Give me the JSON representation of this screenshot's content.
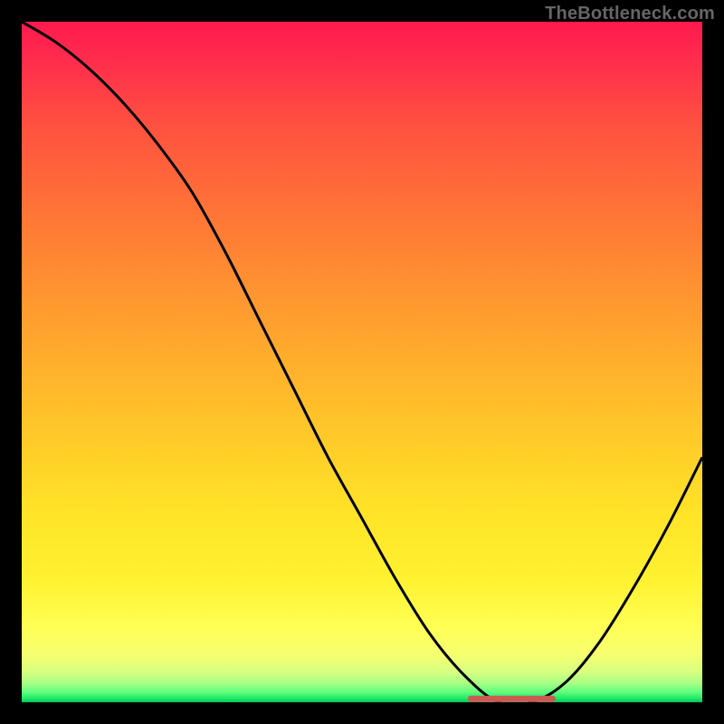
{
  "watermark": "TheBottleneck.com",
  "chart_data": {
    "type": "line",
    "title": "",
    "xlabel": "",
    "ylabel": "",
    "xlim": [
      0,
      100
    ],
    "ylim": [
      0,
      100
    ],
    "grid": false,
    "legend": false,
    "series": [
      {
        "name": "bottleneck-curve",
        "x": [
          0,
          5,
          10,
          15,
          20,
          25,
          30,
          35,
          40,
          45,
          50,
          55,
          60,
          65,
          70,
          75,
          80,
          85,
          90,
          95,
          100
        ],
        "values": [
          100,
          97,
          93,
          88,
          82,
          75,
          66,
          56,
          46,
          36,
          27,
          18,
          10,
          4,
          0,
          0,
          3,
          9,
          17,
          26,
          36
        ]
      },
      {
        "name": "highlight-segment",
        "x": [
          66,
          78
        ],
        "values": [
          0.5,
          0.5
        ]
      }
    ],
    "highlight_range": {
      "start": 66,
      "end": 78
    },
    "background_gradient_stops": [
      {
        "pct": 0.0,
        "color": "#ff1a4d"
      },
      {
        "pct": 0.05,
        "color": "#ff2a4d"
      },
      {
        "pct": 0.15,
        "color": "#ff5040"
      },
      {
        "pct": 0.3,
        "color": "#ff7a35"
      },
      {
        "pct": 0.45,
        "color": "#ffa22e"
      },
      {
        "pct": 0.6,
        "color": "#ffc729"
      },
      {
        "pct": 0.72,
        "color": "#ffe327"
      },
      {
        "pct": 0.82,
        "color": "#fff230"
      },
      {
        "pct": 0.89,
        "color": "#ffff55"
      },
      {
        "pct": 0.93,
        "color": "#f6ff70"
      },
      {
        "pct": 0.955,
        "color": "#d8ff80"
      },
      {
        "pct": 0.972,
        "color": "#a8ff85"
      },
      {
        "pct": 0.985,
        "color": "#5fff7d"
      },
      {
        "pct": 0.994,
        "color": "#23e868"
      },
      {
        "pct": 1.0,
        "color": "#00c853"
      }
    ],
    "line_color": "#000000",
    "highlight_color": "#cc5a53"
  }
}
